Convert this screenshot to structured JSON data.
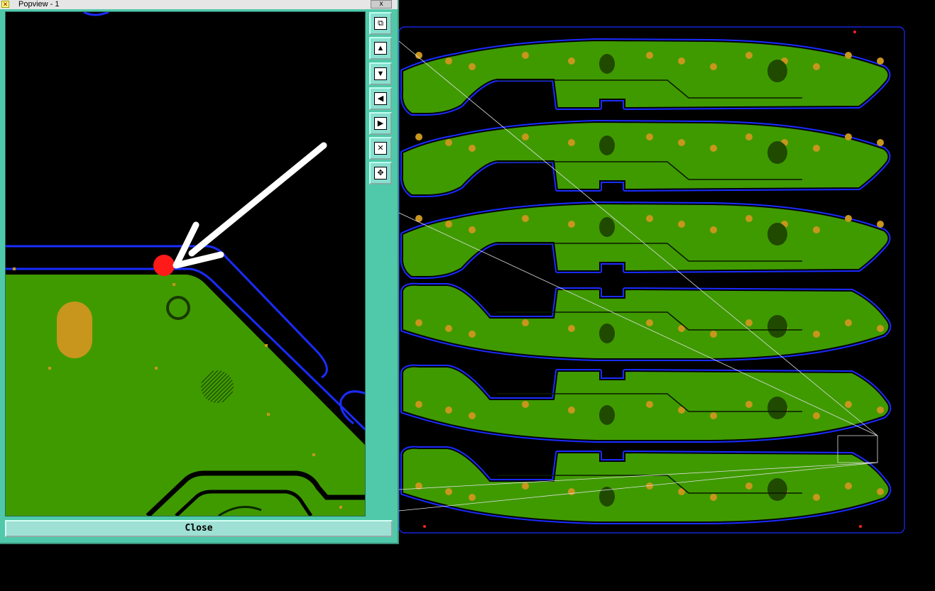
{
  "popview": {
    "title": "Popview - 1",
    "close_glyph": "x",
    "close_label": "Close",
    "toolbar": [
      {
        "name": "zoom-window-icon",
        "glyph": "⧉"
      },
      {
        "name": "pan-up-icon",
        "glyph": "▲"
      },
      {
        "name": "pan-down-icon",
        "glyph": "▼"
      },
      {
        "name": "pan-left-icon",
        "glyph": "◀"
      },
      {
        "name": "pan-right-icon",
        "glyph": "▶"
      },
      {
        "name": "zoom-fit-icon",
        "glyph": "✕"
      },
      {
        "name": "zoom-center-icon",
        "glyph": "✥"
      }
    ]
  },
  "colors": {
    "board_fill": "#3f9a00",
    "outline": "#1a2cff",
    "pad": "#c8961c",
    "marker": "#ff1a1a",
    "window_bg": "#4fc9a9"
  },
  "board": {
    "panel_count": 6
  }
}
